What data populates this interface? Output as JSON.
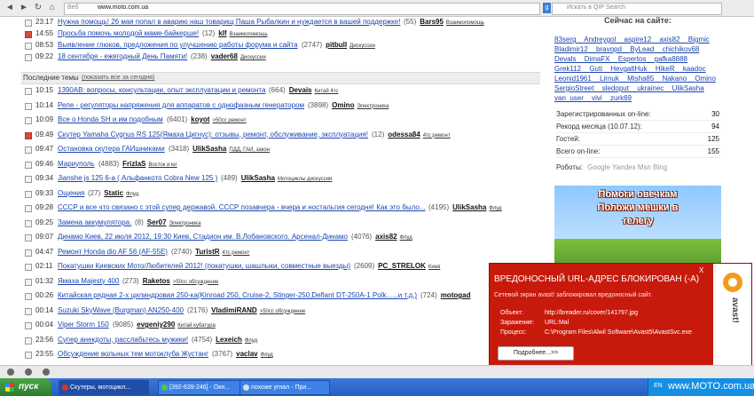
{
  "browser": {
    "url_prefix": "Веб",
    "url": "www.moto.com.ua",
    "search_placeholder": "Искать в QIP Search"
  },
  "pinned": [
    {
      "time": "23:17",
      "title": "Нужна помощь! 26 мая попал в аварию наш товарищ Паша Рыбалкин и нуждается в вашей поддержке!",
      "meta": "(55)",
      "author": "Bars95",
      "forum": "Взаимопомощь",
      "icon": "gray"
    },
    {
      "time": "14:55",
      "title": "Просьба помочь молодой маме-байкерше!",
      "meta": "(12)",
      "author": "klf",
      "forum": "Взаимопомощь",
      "icon": "red"
    },
    {
      "time": "08:53",
      "title": "Выявление глюков, предложения по улучшению работы форума и сайта",
      "meta": "(2747)",
      "author": "pitbull",
      "forum": "Дискуссии",
      "icon": "gray"
    },
    {
      "time": "09:22",
      "title": "18 сентября - ежегодный День Памяти!",
      "meta": "(238)",
      "author": "vader68",
      "forum": "Дискуссии",
      "icon": "gray"
    }
  ],
  "separator": {
    "title": "Последние темы",
    "link": "(показать все за сегодня)"
  },
  "topics": [
    {
      "time": "10:15",
      "title": "1390АВ: вопросы, консультации, опыт эксплуатации и ремонта",
      "meta": "(664)",
      "author": "Devais",
      "forum": "Китай 4тс",
      "icon": "gray"
    },
    {
      "time": "10:14",
      "title": "Реле - регуляторы напряжения для аппаратов с однофазным генератором",
      "meta": "(3898)",
      "author": "Omino",
      "forum": "Электроника",
      "icon": "gray"
    },
    {
      "time": "10:09",
      "title": "Все о Honda SH и им подобным",
      "meta": "(6401)",
      "author": "koyot",
      "forum": ">50сс ремонт",
      "icon": "gray"
    },
    {
      "time": "09:49",
      "title": "Скутер Yamaha Cygnus RS 125(Ямаха Цигнус): отзывы, ремонт, обслуживание, эксплуатация!",
      "meta": "(12)",
      "author": "odessa84",
      "forum": "4тс ремонт",
      "icon": "red"
    },
    {
      "time": "09:47",
      "title": "Остановка скутера ГАИшниками",
      "meta": "(3418)",
      "author": "UlikSasha",
      "forum": "ПДД, ГАИ, закон",
      "icon": "gray"
    },
    {
      "time": "09:46",
      "title": "Мариуполь",
      "meta": "(4883)",
      "author": "FrizlaS",
      "forum": "Восток и юг",
      "icon": "gray"
    },
    {
      "time": "09:34",
      "title": "Jianshe js 125 6-а ( Альфанкото Cobra New 125 )",
      "meta": "(489)",
      "author": "UlikSasha",
      "forum": "Мотоциклы дискуссии",
      "icon": "gray"
    },
    {
      "time": "09:33",
      "title": "Ощения",
      "meta": "(27)",
      "author": "Static",
      "forum": "Флуд",
      "icon": "gray"
    },
    {
      "time": "09:28",
      "title": "СССР и все что связано с этой супер державой. СССР позавчера - вчера и ностальгия сегодня! Как это было...",
      "meta": "(4195)",
      "author": "UlikSasha",
      "forum": "Флуд",
      "icon": "gray"
    },
    {
      "time": "09:25",
      "title": "Замена аккумулятора.",
      "meta": "(8)",
      "author": "Ser07",
      "forum": "Электроника",
      "icon": "gray"
    },
    {
      "time": "09:07",
      "title": "Динамо Киев, 22 июля 2012, 19:30 Киев, Стадион им. В.Лобановского. Арсенал-Динамо",
      "meta": "(4076)",
      "author": "axis82",
      "forum": "Флуд",
      "icon": "gray"
    },
    {
      "time": "04:47",
      "title": "Ремонт Honda dio AF 56 (AF-55Е)",
      "meta": "(2740)",
      "author": "TuristR",
      "forum": "4тс ремонт",
      "icon": "gray"
    },
    {
      "time": "02:11",
      "title": "Покатушки Киевских Мото/Любителей 2012! (покатушки, шашлыки, совместные выезды)",
      "meta": "(2609)",
      "author": "PC_STRELOK",
      "forum": "Киев",
      "icon": "gray"
    },
    {
      "time": "01:32",
      "title": "Ямаха Majesty 400",
      "meta": "(273)",
      "author": "Raketos",
      "forum": ">50сс обсуждение",
      "icon": "gray"
    },
    {
      "time": "00:26",
      "title": "Китайская рядная 2-х цилиндровая 250-ка(Kinroad 250, Cruise-2, Stinger-250,Deflant DT-250A-1 Polk......и т.д.)",
      "meta": "(724)",
      "author": "motogad",
      "forum": "",
      "icon": "gray"
    },
    {
      "time": "00:14",
      "title": "Suzuki SkyWave (Burgman) AN250-400",
      "meta": "(2176)",
      "author": "VladimiRAND",
      "forum": ">50сс обсуждение",
      "icon": "gray"
    },
    {
      "time": "00:04",
      "title": "Viper Storm 150",
      "meta": "(9085)",
      "author": "evgeniy290",
      "forum": "Китай кубатура",
      "icon": "gray"
    },
    {
      "time": "23:56",
      "title": "Супер анекдоты, расслабьтесь мужики!",
      "meta": "(4754)",
      "author": "Lexeich",
      "forum": "Флуд",
      "icon": "gray"
    },
    {
      "time": "23:55",
      "title": "Обсуждение вольных тем мотоклуба Жустанг",
      "meta": "(3767)",
      "author": "vaclav",
      "forum": "Флуд",
      "icon": "gray"
    }
  ],
  "sidebar": {
    "title": "Сейчас на сайте:",
    "users": [
      "83serg",
      "Andreygol",
      "aspire12",
      "axis82",
      "Bigmic",
      "Bladimir12",
      "bravopd",
      "ByLead",
      "chichikov68",
      "Devals",
      "DimaFX",
      "Espertos",
      "gafka8888",
      "Grek112",
      "Guti",
      "HevgaltHuk",
      "HikeR",
      "kaadoc",
      "Leonid1961",
      "Lirnuk",
      "Misha85",
      "Nakano",
      "Omino",
      "SergioStreet",
      "sledoput",
      "ukrainec",
      "UlikSasha",
      "van_user",
      "vivi",
      "zurk69"
    ],
    "stats": [
      {
        "label": "Зарегистрированных on-line:",
        "value": "30"
      },
      {
        "label": "Рекорд месяца (10.07.12):",
        "value": "94"
      },
      {
        "label": "Гостей:",
        "value": "125"
      },
      {
        "label": "Всего on-line:",
        "value": "155"
      }
    ],
    "robots_label": "Роботы:",
    "robots": "Google  Yandex  Msn  Bing",
    "banner_line1": "Помоги овечкам",
    "banner_line2": "Положи мешки в",
    "banner_line3": "телегу"
  },
  "popup": {
    "title": "ВРЕДОНОСНЫЙ URL-АДРЕС БЛОКИРОВАН (-A)",
    "subtitle": "Сетевой экран avast! заблокировал вредоносный сайт.",
    "object_label": "Объект:",
    "object_value": "http://breader.ru/cover/141797.jpg",
    "infection_label": "Заражение:",
    "infection_value": "URL:Mal",
    "process_label": "Процесс:",
    "process_value": "C:\\Program Files\\Alwil Software\\Avast5\\AvastSvc.exe",
    "button": "Подробнее...>>",
    "brand": "avast!",
    "close": "X"
  },
  "taskbar": {
    "start": "пуск",
    "items": [
      {
        "label": "Скутеры, мотоцикл...",
        "color": "#d32",
        "active": true
      },
      {
        "label": "[392-639-246] - Окн...",
        "color": "#4c4",
        "active": false
      },
      {
        "label": "похоже угнал - При...",
        "color": "#ddd",
        "active": false
      }
    ],
    "lang": "EN",
    "watermark": "www.MOTO.com.ua"
  }
}
